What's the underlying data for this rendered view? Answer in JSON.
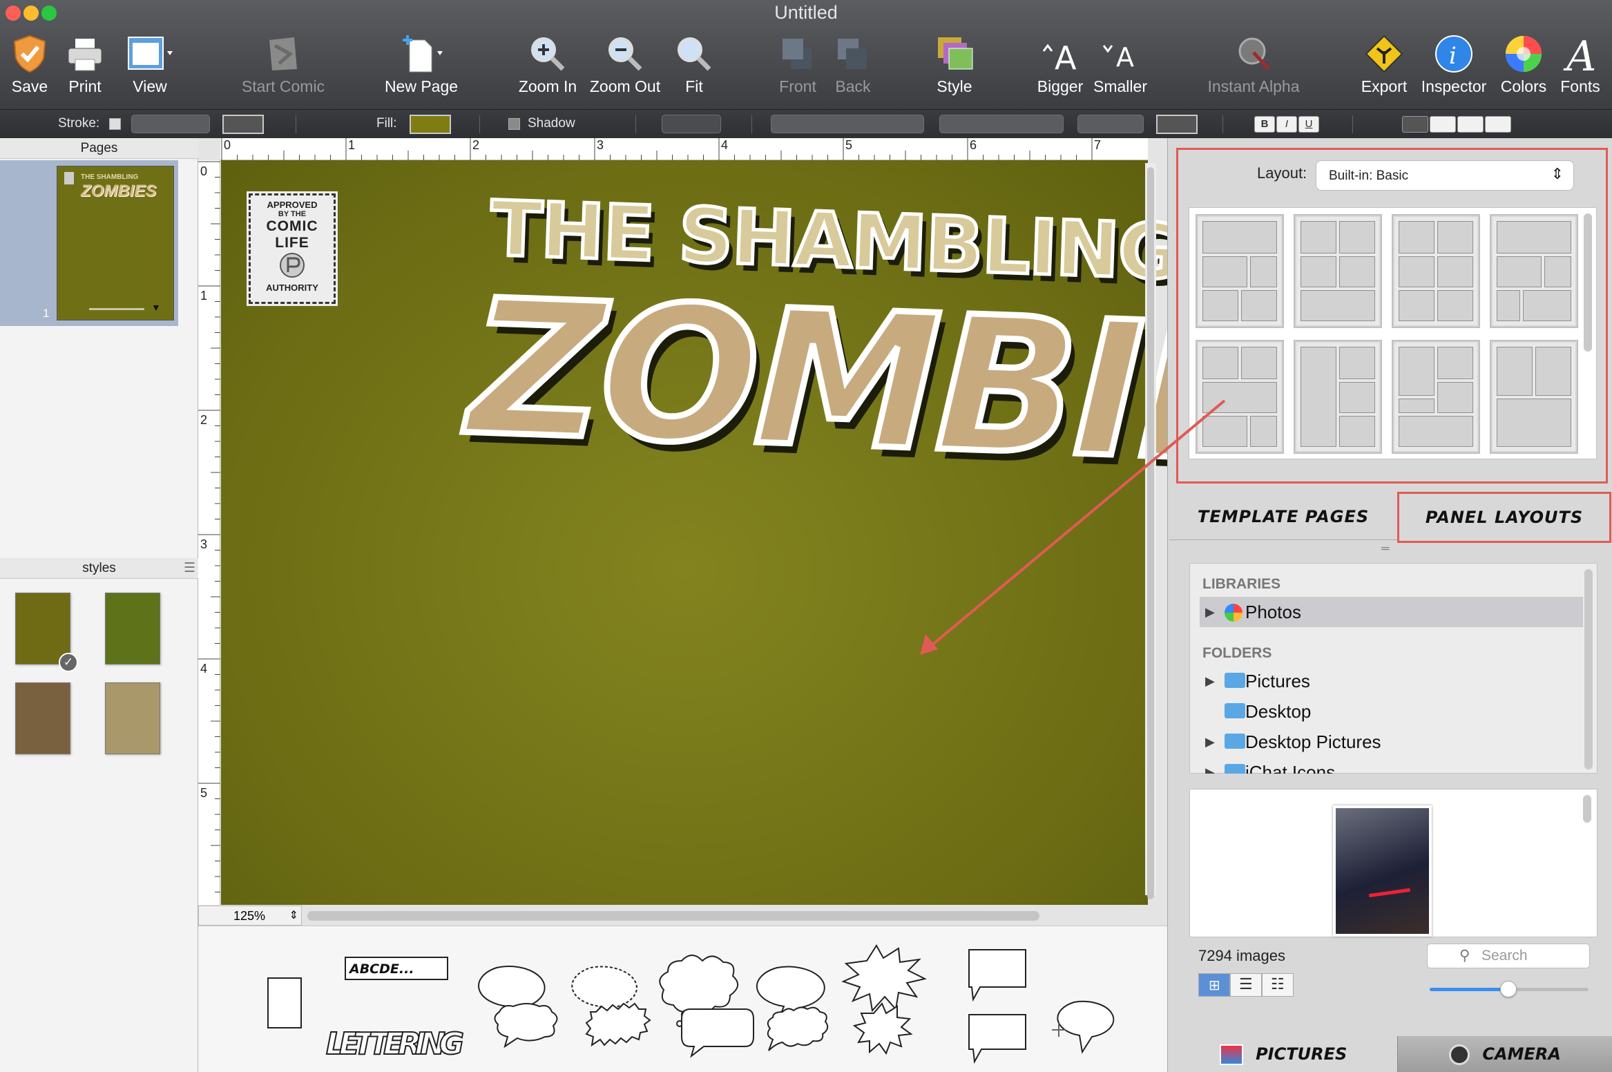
{
  "window": {
    "title": "Untitled",
    "controls": [
      "close",
      "minimize",
      "zoom"
    ]
  },
  "toolbar": {
    "items": [
      {
        "label": "Save",
        "icon": "save-badge-icon",
        "enabled": true
      },
      {
        "label": "Print",
        "icon": "printer-icon",
        "enabled": true
      },
      {
        "label": "View",
        "icon": "view-window-icon",
        "enabled": true
      },
      {
        "label": "Start Comic",
        "icon": "start-comic-icon",
        "enabled": false
      },
      {
        "label": "New Page",
        "icon": "new-page-icon",
        "enabled": true
      },
      {
        "label": "Zoom In",
        "icon": "zoom-in-icon",
        "enabled": true
      },
      {
        "label": "Zoom Out",
        "icon": "zoom-out-icon",
        "enabled": true
      },
      {
        "label": "Fit",
        "icon": "fit-icon",
        "enabled": true
      },
      {
        "label": "Front",
        "icon": "bring-front-icon",
        "enabled": false
      },
      {
        "label": "Back",
        "icon": "send-back-icon",
        "enabled": false
      },
      {
        "label": "Style",
        "icon": "style-icon",
        "enabled": true
      },
      {
        "label": "Bigger",
        "icon": "bigger-text-icon",
        "enabled": true
      },
      {
        "label": "Smaller",
        "icon": "smaller-text-icon",
        "enabled": true
      },
      {
        "label": "Instant Alpha",
        "icon": "instant-alpha-icon",
        "enabled": false
      },
      {
        "label": "Export",
        "icon": "export-icon",
        "enabled": true
      },
      {
        "label": "Inspector",
        "icon": "inspector-info-icon",
        "enabled": true
      },
      {
        "label": "Colors",
        "icon": "color-wheel-icon",
        "enabled": true
      },
      {
        "label": "Fonts",
        "icon": "fonts-icon",
        "enabled": true
      }
    ]
  },
  "formatbar": {
    "stroke_label": "Stroke:",
    "fill_label": "Fill:",
    "shadow_label": "Shadow",
    "fill_color": "#807c14",
    "text_style_buttons": [
      "B",
      "I",
      "U"
    ]
  },
  "pages_panel": {
    "title": "Pages",
    "pages": [
      {
        "number": "1",
        "title_top": "THE SHAMBLING",
        "title_main": "ZOMBIES"
      }
    ]
  },
  "styles_panel": {
    "title": "styles",
    "swatches": [
      {
        "color": "#6e6b14",
        "selected": true
      },
      {
        "color": "#5d7219",
        "selected": false
      },
      {
        "color": "#79603f",
        "selected": false
      },
      {
        "color": "#a8986a",
        "selected": false
      }
    ]
  },
  "document": {
    "background_color": "#777818",
    "title_top": "THE SHAMBLING",
    "title_main": "ZOMBIES",
    "stamp": [
      "APPROVED",
      "BY THE",
      "COMIC",
      "LIFE",
      "AUTHORITY"
    ],
    "ruler_h": [
      "0",
      "1",
      "2",
      "3",
      "4",
      "5",
      "6",
      "7"
    ],
    "ruler_v": [
      "0",
      "1",
      "2",
      "3",
      "4",
      "5"
    ],
    "zoom": "125%"
  },
  "palette": {
    "caption_sample": "ABCDE...",
    "lettering_sample": "LETTERING"
  },
  "inspector": {
    "layout_label": "Layout:",
    "layout_value": "Built-in: Basic",
    "tabs": [
      "TEMPLATE PAGES",
      "PANEL LAYOUTS"
    ],
    "active_tab": "PANEL LAYOUTS",
    "highlight_color": "#e05b55",
    "libraries_heading": "LIBRARIES",
    "libraries": [
      {
        "label": "Photos",
        "selected": true
      }
    ],
    "folders_heading": "FOLDERS",
    "folders": [
      {
        "label": "Pictures",
        "expandable": true
      },
      {
        "label": "Desktop",
        "expandable": false
      },
      {
        "label": "Desktop Pictures",
        "expandable": true
      },
      {
        "label": "iChat Icons",
        "expandable": true
      }
    ],
    "image_count": "7294 images",
    "search_placeholder": "Search",
    "thumbnail_size": 0.5,
    "bottom_tabs": [
      "PICTURES",
      "CAMERA"
    ]
  }
}
